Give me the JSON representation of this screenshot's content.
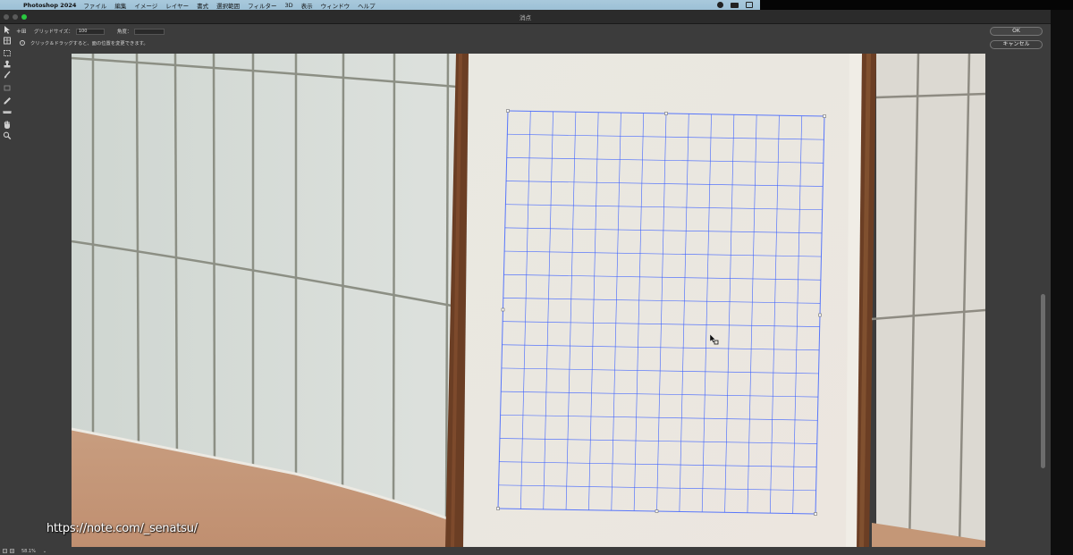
{
  "menubar": {
    "apple": "",
    "app_name": "Photoshop 2024",
    "items": [
      "ファイル",
      "編集",
      "イメージ",
      "レイヤー",
      "書式",
      "選択範囲",
      "フィルター",
      "3D",
      "表示",
      "ウィンドウ",
      "ヘルプ"
    ]
  },
  "window": {
    "title": "消点"
  },
  "options": {
    "grid_size_label": "グリッドサイズ：",
    "grid_size_value": "100",
    "angle_label": "角度："
  },
  "info": {
    "message": "クリック＆ドラッグすると、面の位置を変更できます。"
  },
  "buttons": {
    "ok": "OK",
    "cancel": "キャンセル"
  },
  "tools": [
    "edit-plane-tool-icon",
    "create-plane-tool-icon",
    "marquee-tool-icon",
    "stamp-tool-icon",
    "brush-tool-icon",
    "transform-tool-icon",
    "eyedropper-tool-icon",
    "measure-tool-icon",
    "hand-tool-icon",
    "zoom-tool-icon"
  ],
  "status": {
    "zoom": "58.1%"
  },
  "watermark": "https://note.com/_senatsu/",
  "colors": {
    "grid": "#3f63ff",
    "frame": "#6b3e24",
    "wall": "#d7ddd9",
    "floor": "#c69a7b"
  }
}
